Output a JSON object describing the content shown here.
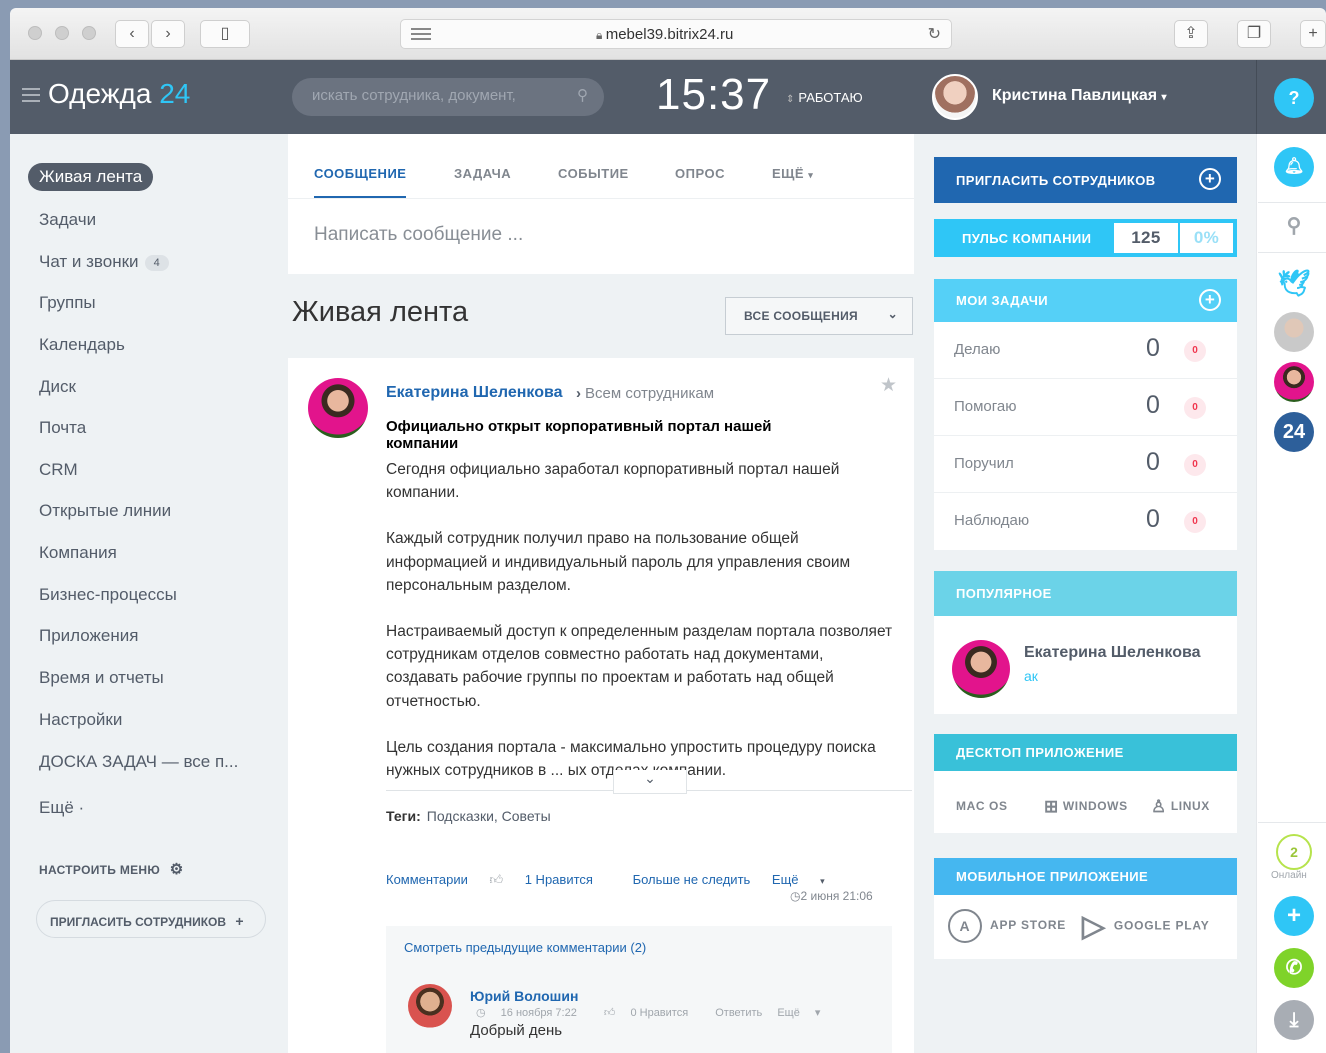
{
  "browser": {
    "url": "mebel39.bitrix24.ru"
  },
  "header": {
    "logo_text": "Одежда",
    "logo_num": "24",
    "search_placeholder": "искать сотрудника, документ,",
    "clock": "15:37",
    "work_status": "РАБОТАЮ",
    "user_name": "Кристина Павлицкая",
    "help": "?"
  },
  "sidebar": {
    "items": [
      {
        "label": "Живая лента"
      },
      {
        "label": "Задачи"
      },
      {
        "label": "Чат и звонки",
        "badge": "4"
      },
      {
        "label": "Группы"
      },
      {
        "label": "Календарь"
      },
      {
        "label": "Диск"
      },
      {
        "label": "Почта"
      },
      {
        "label": "CRM"
      },
      {
        "label": "Открытые линии"
      },
      {
        "label": "Компания"
      },
      {
        "label": "Бизнес-процессы"
      },
      {
        "label": "Приложения"
      },
      {
        "label": "Время и отчеты"
      },
      {
        "label": "Настройки"
      },
      {
        "label": "ДОСКА ЗАДАЧ — все п..."
      },
      {
        "label": "Ещё ·"
      }
    ],
    "configure_menu": "НАСТРОИТЬ МЕНЮ",
    "invite": "ПРИГЛАСИТЬ СОТРУДНИКОВ"
  },
  "composer": {
    "tabs": [
      "СООБЩЕНИЕ",
      "ЗАДАЧА",
      "СОБЫТИЕ",
      "ОПРОС",
      "ЕЩЁ"
    ],
    "placeholder": "Написать сообщение ..."
  },
  "feed": {
    "title": "Живая лента",
    "filter": "ВСЕ СООБЩЕНИЯ"
  },
  "post": {
    "author": "Екатерина Шеленкова",
    "destination": "Всем сотрудникам",
    "title": "Официально открыт корпоративный портал нашей компании",
    "paragraphs": [
      "Сегодня официально заработал корпоративный портал нашей компании.",
      "Каждый сотрудник получил право на пользование общей информацией и индивидуальный пароль для управления своим персональным разделом.",
      "Настраиваемый доступ к определенным разделам портала позволяет сотрудникам отделов совместно работать над документами, создавать рабочие группы по проектам и работать над общей отчетностью.",
      "Цель создания портала - максимально упростить процедуру поиска нужных сотрудников в ... ых отделах компании."
    ],
    "tags_label": "Теги:",
    "tags": "Подсказки, Советы",
    "actions": {
      "comments": "Комментарии",
      "like": "1 Нравится",
      "unfollow": "Больше не следить",
      "more": "Ещё"
    },
    "date": "2 июня 21:06",
    "prev_comments": "Смотреть предыдущие комментарии (2)",
    "comment": {
      "author": "Юрий Волошин",
      "date": "16 ноября 7:22",
      "likes": "0 Нравится",
      "reply": "Ответить",
      "more": "Ещё",
      "text": "Добрый день"
    }
  },
  "right": {
    "invite": "ПРИГЛАСИТЬ СОТРУДНИКОВ",
    "pulse_label": "ПУЛЬС КОМПАНИИ",
    "pulse_value": "125",
    "pulse_percent": "0%",
    "tasks_header": "МОИ ЗАДАЧИ",
    "tasks": [
      {
        "label": "Делаю",
        "count": "0",
        "new": "0"
      },
      {
        "label": "Помогаю",
        "count": "0",
        "new": "0"
      },
      {
        "label": "Поручил",
        "count": "0",
        "new": "0"
      },
      {
        "label": "Наблюдаю",
        "count": "0",
        "new": "0"
      }
    ],
    "popular_header": "ПОПУЛЯРНОЕ",
    "popular_name": "Екатерина Шеленкова",
    "popular_sub": "ак",
    "desktop_header": "ДЕСКТОП ПРИЛОЖЕНИЕ",
    "os": [
      "MAC OS",
      "WINDOWS",
      "LINUX"
    ],
    "mobile_header": "МОБИЛЬНОЕ ПРИЛОЖЕНИЕ",
    "stores": [
      "APP STORE",
      "GOOGLE PLAY"
    ]
  },
  "rail": {
    "b24_label": "24",
    "online_count": "2",
    "online_label": "Онлайн"
  }
}
